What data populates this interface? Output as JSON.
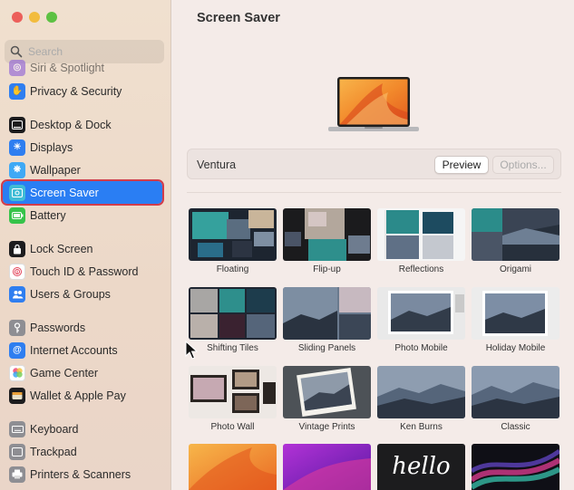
{
  "search": {
    "placeholder": "Search"
  },
  "sidebar": {
    "items": [
      {
        "label": "Siri & Spotlight",
        "icon": "siri-icon",
        "color": "#8a5cd8"
      },
      {
        "label": "Privacy & Security",
        "icon": "hand-icon",
        "color": "#2f7ef0"
      },
      {
        "label": "Desktop & Dock",
        "icon": "dock-icon",
        "color": "#1c1c1e"
      },
      {
        "label": "Displays",
        "icon": "sun-icon",
        "color": "#2f7ef0"
      },
      {
        "label": "Wallpaper",
        "icon": "snowflake-icon",
        "color": "#3fa9f5"
      },
      {
        "label": "Screen Saver",
        "icon": "screensaver-icon",
        "color": "#3fbcd6"
      },
      {
        "label": "Battery",
        "icon": "battery-icon",
        "color": "#36c34a"
      },
      {
        "label": "Lock Screen",
        "icon": "lock-icon",
        "color": "#1c1c1e"
      },
      {
        "label": "Touch ID & Password",
        "icon": "fingerprint-icon",
        "color": "#ffffff"
      },
      {
        "label": "Users & Groups",
        "icon": "users-icon",
        "color": "#2f7ef0"
      },
      {
        "label": "Passwords",
        "icon": "key-icon",
        "color": "#8e8e93"
      },
      {
        "label": "Internet Accounts",
        "icon": "at-icon",
        "color": "#2f7ef0"
      },
      {
        "label": "Game Center",
        "icon": "gamecenter-icon",
        "color": "#ffffff"
      },
      {
        "label": "Wallet & Apple Pay",
        "icon": "wallet-icon",
        "color": "#1c1c1e"
      },
      {
        "label": "Keyboard",
        "icon": "keyboard-icon",
        "color": "#8e8e93"
      },
      {
        "label": "Trackpad",
        "icon": "trackpad-icon",
        "color": "#8e8e93"
      },
      {
        "label": "Printers & Scanners",
        "icon": "printer-icon",
        "color": "#8e8e93"
      }
    ],
    "selected": "Screen Saver",
    "accent": "#2a7ef3",
    "highlight": "#d23c4a"
  },
  "main": {
    "title": "Screen Saver",
    "current_name": "Ventura",
    "preview_label": "Preview",
    "options_label": "Options...",
    "savers": [
      {
        "label": "Floating"
      },
      {
        "label": "Flip-up"
      },
      {
        "label": "Reflections"
      },
      {
        "label": "Origami"
      },
      {
        "label": "Shifting Tiles"
      },
      {
        "label": "Sliding Panels"
      },
      {
        "label": "Photo Mobile"
      },
      {
        "label": "Holiday Mobile"
      },
      {
        "label": "Photo Wall"
      },
      {
        "label": "Vintage Prints"
      },
      {
        "label": "Ken Burns"
      },
      {
        "label": "Classic"
      },
      {
        "label": ""
      },
      {
        "label": ""
      },
      {
        "label": ""
      },
      {
        "label": ""
      }
    ],
    "hello_text": "hello"
  }
}
